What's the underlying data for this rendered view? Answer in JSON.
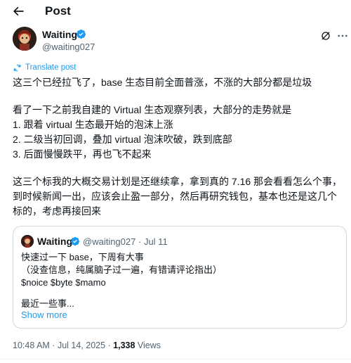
{
  "header": {
    "title": "Post",
    "back_icon": "arrow-left-icon"
  },
  "author": {
    "name": "Waiting",
    "handle": "@waiting027",
    "verified": true,
    "verified_color": "#1d9bf0"
  },
  "translate": {
    "label": "Translate post"
  },
  "tweet": {
    "lines": [
      "这三个已经拉飞了，base 生态目前全面普涨，不涨的大部分都是垃圾",
      "",
      "看了一下之前我自建的 Virtual 生态观察列表，大部分的走势就是",
      "1. 跟着 virtual 生态最开始的泡沫上涨",
      "2. 二级当初回调，叠加 virtual 泡沫吹破，跌到底部",
      "3. 后面慢慢跌平，再也飞不起来",
      "",
      "这三个标我的大概交易计划是还继续拿，拿到真的 7.16 那会看看怎么个事，",
      "到时候新闻一出，应该会止盈一部分，然后再研究钱包，基本也还是这几个",
      "标的，考虑再接回来"
    ]
  },
  "quote": {
    "name": "Waiting",
    "handle": "@waiting027",
    "separator": "·",
    "date": "Jul 11",
    "lines": [
      "快速过一下 base，下周有大事",
      "（没查信息，纯属脑子过一遍，有错请评论指出）",
      "$noice $byte $mamo",
      "",
      "最近一些事..."
    ],
    "show_more": "Show more"
  },
  "footer": {
    "time": "10:48 AM",
    "sep1": " · ",
    "date": "Jul 14, 2025",
    "sep2": " · ",
    "views": "1,338",
    "views_label": " Views"
  },
  "colors": {
    "accent": "#1d9bf0",
    "text": "#0f1419",
    "muted": "#536471",
    "border": "#cfd9de"
  }
}
